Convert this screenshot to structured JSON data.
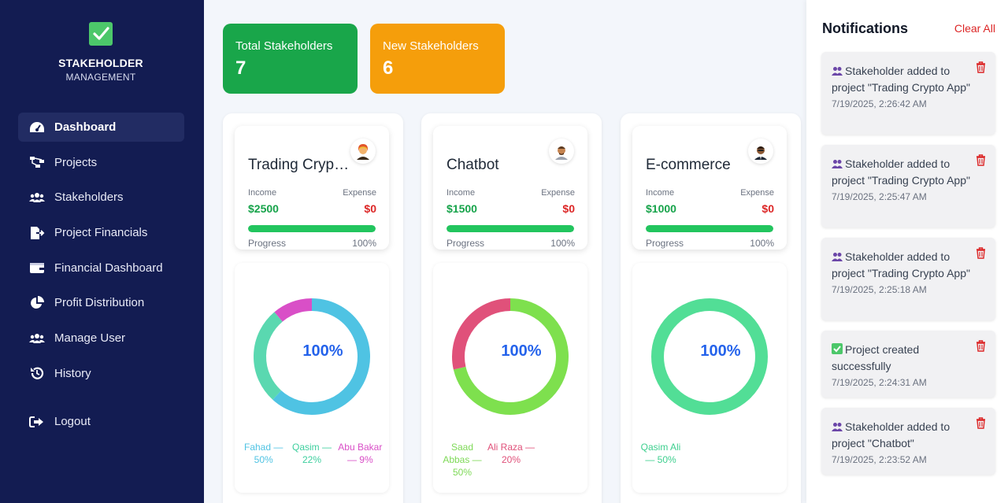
{
  "brand": {
    "title": "STAKEHOLDER",
    "subtitle": "MANAGEMENT",
    "icon": "check-square-icon"
  },
  "nav": [
    {
      "label": "Dashboard",
      "icon": "gauge-icon",
      "active": true
    },
    {
      "label": "Projects",
      "icon": "sitemap-icon"
    },
    {
      "label": "Stakeholders",
      "icon": "users-icon"
    },
    {
      "label": "Project Financials",
      "icon": "file-export-icon"
    },
    {
      "label": "Financial Dashboard",
      "icon": "wallet-icon"
    },
    {
      "label": "Profit Distribution",
      "icon": "pie-chart-icon"
    },
    {
      "label": "Manage User",
      "icon": "users-icon"
    },
    {
      "label": "History",
      "icon": "history-icon"
    }
  ],
  "logout": {
    "label": "Logout",
    "icon": "sign-out-icon"
  },
  "stats": {
    "total": {
      "label": "Total Stakeholders",
      "value": "7",
      "color": "#19a64a"
    },
    "new": {
      "label": "New Stakeholders",
      "value": "6",
      "color": "#f59e0b"
    }
  },
  "labels": {
    "income": "Income",
    "expense": "Expense",
    "progress": "Progress"
  },
  "projects": [
    {
      "name": "Trading Crypto App",
      "income": "$2500",
      "expense": "$0",
      "progress_text": "100%",
      "progress": 1.0,
      "center_label": "100%",
      "segments": [
        {
          "name": "Fahad",
          "percent": 50,
          "color": "#4fc3e3"
        },
        {
          "name": "Qasim",
          "percent": 22,
          "color": "#5ad8b0"
        },
        {
          "name": "Abu Bakar",
          "percent": 9,
          "color": "#d94fc7"
        }
      ],
      "legend": [
        {
          "text": "Fahad — 50%",
          "color": "#4fc3e3"
        },
        {
          "text": "Qasim — 22%",
          "color": "#3dcf9e"
        },
        {
          "text": "Abu Bakar — 9%",
          "color": "#d94fc7"
        }
      ]
    },
    {
      "name": "Chatbot",
      "income": "$1500",
      "expense": "$0",
      "progress_text": "100%",
      "progress": 1.0,
      "center_label": "100%",
      "segments": [
        {
          "name": "Saad Abbas",
          "percent": 50,
          "color": "#7ee04e"
        },
        {
          "name": "Ali Raza",
          "percent": 20,
          "color": "#e0517a"
        }
      ],
      "legend": [
        {
          "text": "Saad Abbas — 50%",
          "color": "#7ed957"
        },
        {
          "text": "Ali Raza — 20%",
          "color": "#e0517a"
        }
      ]
    },
    {
      "name": "E-commerce",
      "income": "$1000",
      "expense": "$0",
      "progress_text": "100%",
      "progress": 1.0,
      "center_label": "100%",
      "segments": [
        {
          "name": "Qasim Ali",
          "percent": 50,
          "color": "#52de96"
        }
      ],
      "legend": [
        {
          "text": "Qasim Ali — 50%",
          "color": "#3dcf8e"
        }
      ]
    }
  ],
  "notifications": {
    "title": "Notifications",
    "clear_label": "Clear All",
    "items": [
      {
        "icon": "users-icon",
        "message": "Stakeholder added to project \"Trading Crypto App\"",
        "time": "7/19/2025, 2:26:42 AM"
      },
      {
        "icon": "users-icon",
        "message": "Stakeholder added to project \"Trading Crypto App\"",
        "time": "7/19/2025, 2:25:47 AM"
      },
      {
        "icon": "users-icon",
        "message": "Stakeholder added to project \"Trading Crypto App\"",
        "time": "7/19/2025, 2:25:18 AM"
      },
      {
        "icon": "check-square-icon",
        "message": "Project created successfully",
        "time": "7/19/2025, 2:24:31 AM"
      },
      {
        "icon": "users-icon",
        "message": "Stakeholder added to project \"Chatbot\"",
        "time": "7/19/2025, 2:23:52 AM"
      }
    ]
  }
}
